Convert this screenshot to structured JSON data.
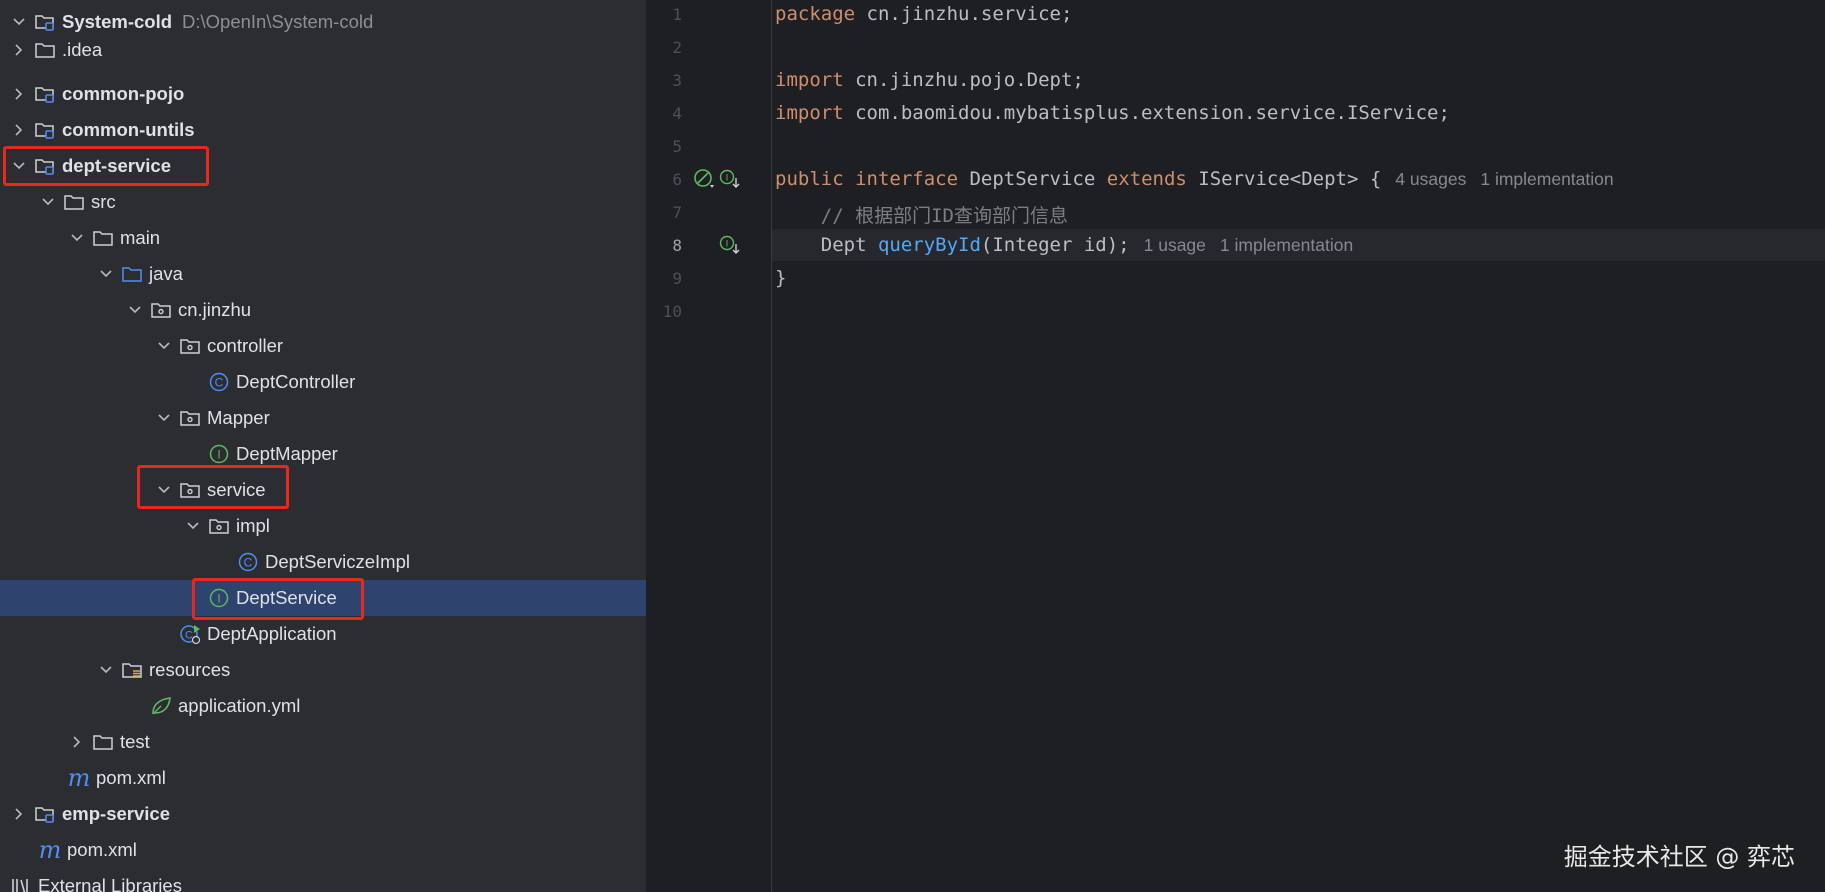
{
  "project": {
    "root": {
      "label": "System-cold",
      "path": "D:\\OpenIn\\System-cold"
    },
    "nodes": [
      {
        "label": "System-cold",
        "hint": "D:\\OpenIn\\System-cold",
        "bold": true
      },
      {
        "label": ".idea"
      },
      {
        "label": "common-pojo",
        "bold": true
      },
      {
        "label": "common-untils",
        "bold": true
      },
      {
        "label": "dept-service",
        "bold": true
      },
      {
        "label": "src"
      },
      {
        "label": "main"
      },
      {
        "label": "java"
      },
      {
        "label": "cn.jinzhu"
      },
      {
        "label": "controller"
      },
      {
        "label": "DeptController"
      },
      {
        "label": "Mapper"
      },
      {
        "label": "DeptMapper"
      },
      {
        "label": "service"
      },
      {
        "label": "impl"
      },
      {
        "label": "DeptServiczeImpl"
      },
      {
        "label": "DeptService"
      },
      {
        "label": "DeptApplication"
      },
      {
        "label": "resources"
      },
      {
        "label": "application.yml"
      },
      {
        "label": "test"
      },
      {
        "label": "pom.xml"
      },
      {
        "label": "emp-service",
        "bold": true
      },
      {
        "label": "pom.xml"
      },
      {
        "label": "External Libraries"
      }
    ],
    "selected": "DeptService"
  },
  "editor": {
    "line_numbers": [
      "1",
      "2",
      "3",
      "4",
      "5",
      "6",
      "7",
      "8",
      "9",
      "10"
    ],
    "current_line": 8,
    "code": {
      "l1_kw": "package",
      "l1_rest": " cn.jinzhu.service;",
      "l3_kw": "import",
      "l3_rest": " cn.jinzhu.pojo.Dept;",
      "l4_kw": "import",
      "l4_rest": " com.baomidou.mybatisplus.extension.service.IService;",
      "l6_kw1": "public",
      "l6_kw2": "interface",
      "l6_name": " DeptService ",
      "l6_kw3": "extends",
      "l6_rest": " IService<Dept> {",
      "l6_usages": "4 usages",
      "l6_impl": "1 implementation",
      "l7_comment": "    // 根据部门ID查询部门信息",
      "l8_type": "    Dept ",
      "l8_fn": "queryById",
      "l8_rest": "(Integer id);",
      "l8_usages": "1 usage",
      "l8_impl": "1 implementation",
      "l9": "}"
    }
  },
  "watermark": "掘金技术社区 @ 弈芯",
  "colors": {
    "highlight_box": "#e6291f",
    "selection": "#2e436e",
    "keyword": "#cf8e6d",
    "method": "#56a8f5"
  }
}
